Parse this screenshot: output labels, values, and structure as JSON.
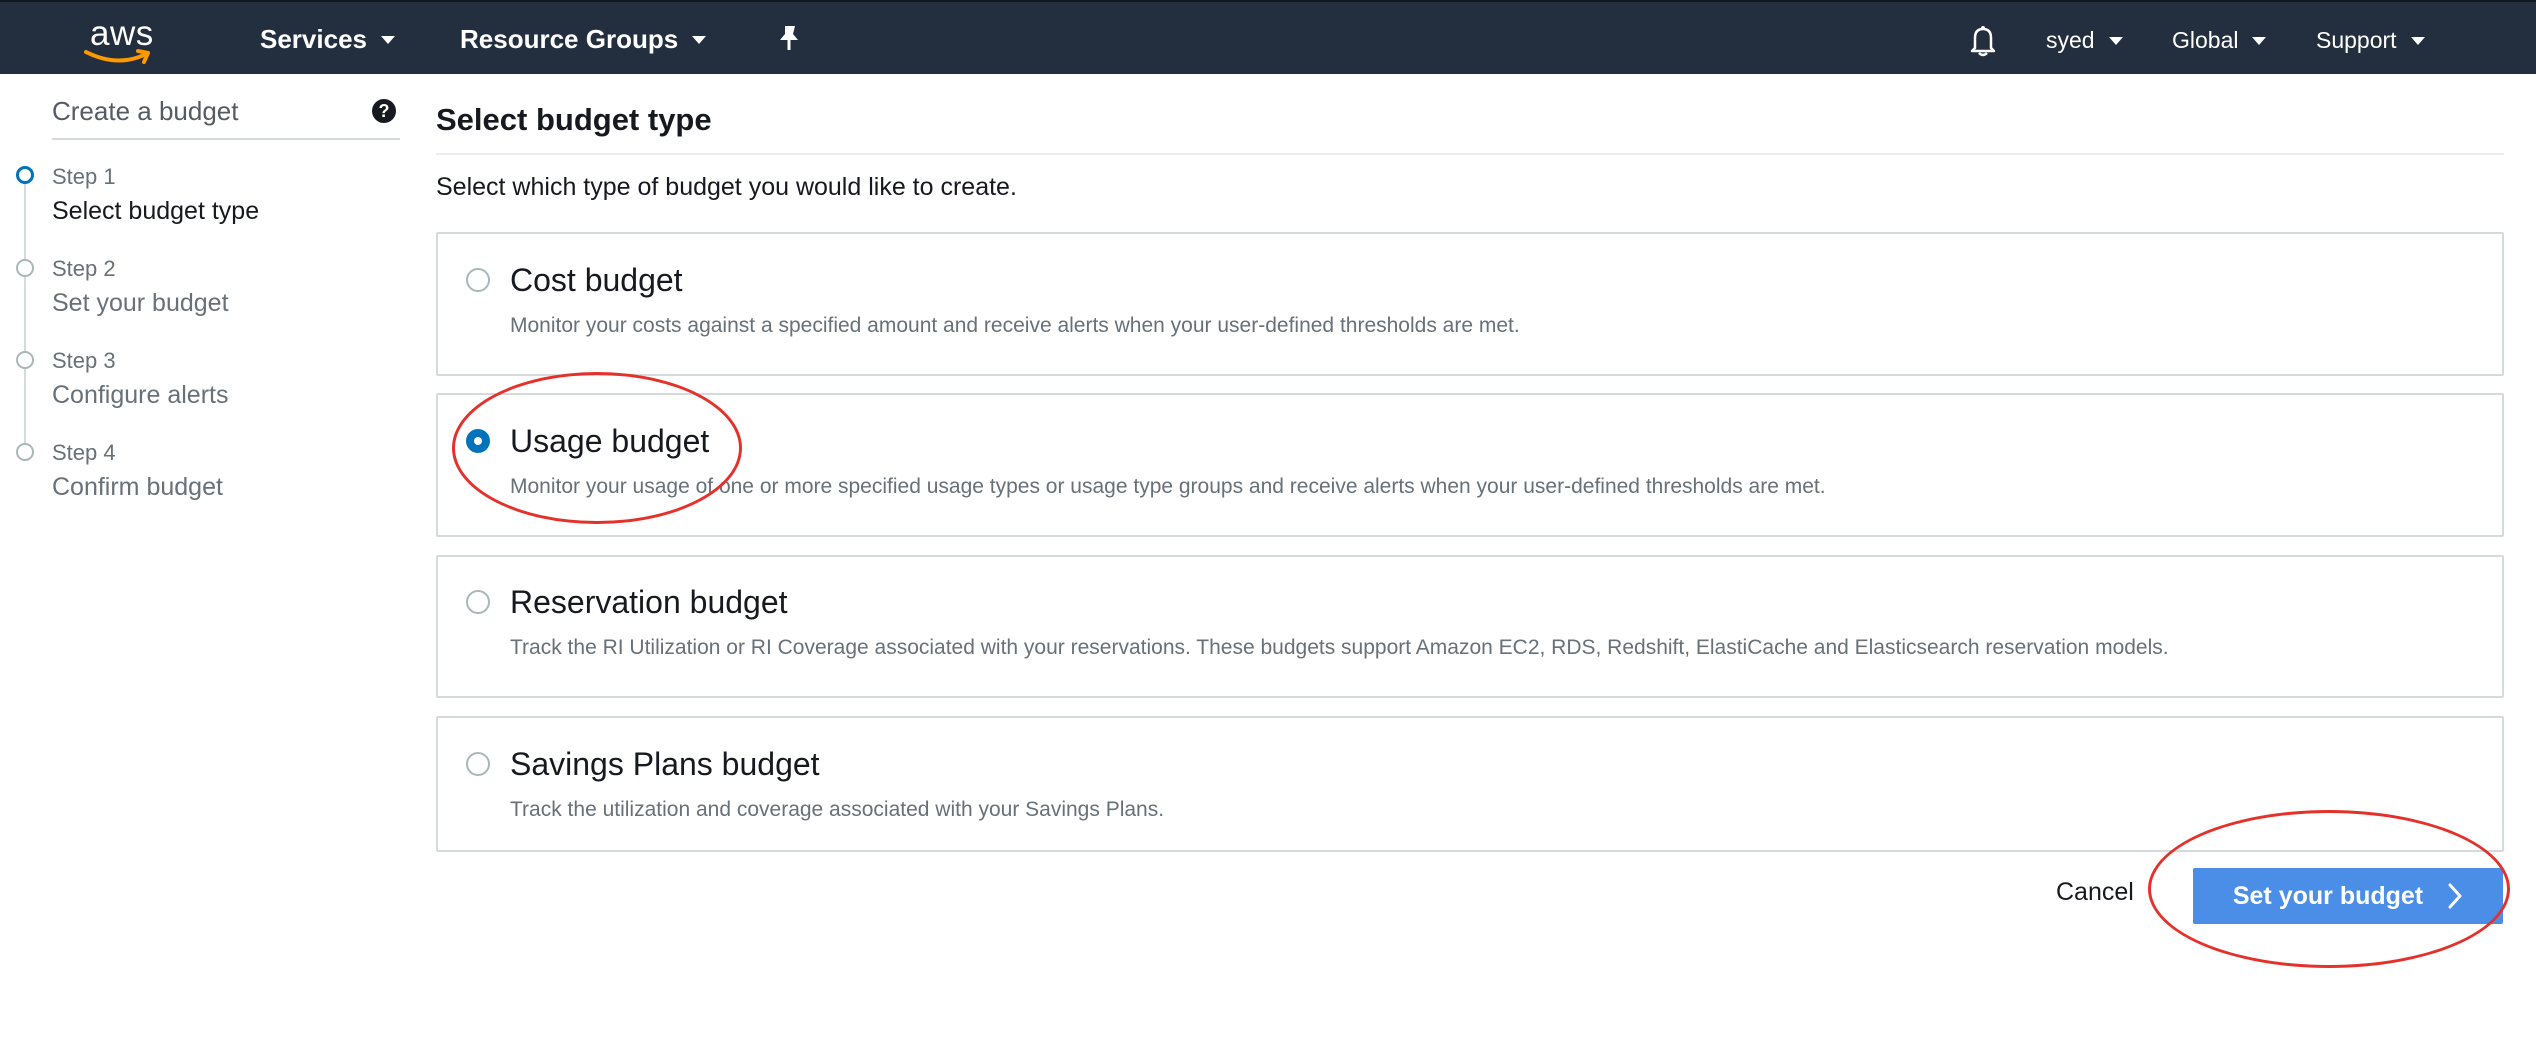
{
  "topbar": {
    "logo_text": "aws",
    "services_label": "Services",
    "resource_groups_label": "Resource Groups",
    "pin_icon": "pin-icon",
    "bell_icon": "bell-icon",
    "user_label": "syed",
    "region_label": "Global",
    "support_label": "Support",
    "bar_color": "#232f3e"
  },
  "sidebar": {
    "title": "Create a budget",
    "help_icon": "question-circle-icon",
    "steps": [
      {
        "num": "Step 1",
        "label": "Select budget type",
        "active": true
      },
      {
        "num": "Step 2",
        "label": "Set your budget",
        "active": false
      },
      {
        "num": "Step 3",
        "label": "Configure alerts",
        "active": false
      },
      {
        "num": "Step 4",
        "label": "Confirm budget",
        "active": false
      }
    ]
  },
  "main": {
    "title": "Select budget type",
    "subtitle": "Select which type of budget you would like to create.",
    "options": [
      {
        "title": "Cost budget",
        "desc": "Monitor your costs against a specified amount and receive alerts when your user-defined thresholds are met.",
        "selected": false
      },
      {
        "title": "Usage budget",
        "desc": "Monitor your usage of one or more specified usage types or usage type groups and receive alerts when your user-defined thresholds are met.",
        "selected": true
      },
      {
        "title": "Reservation budget",
        "desc": "Track the RI Utilization or RI Coverage associated with your reservations. These budgets support Amazon EC2, RDS, Redshift, ElastiCache and Elasticsearch reservation models.",
        "selected": false
      },
      {
        "title": "Savings Plans budget",
        "desc": "Track the utilization and coverage associated with your Savings Plans.",
        "selected": false
      }
    ]
  },
  "footer": {
    "cancel_label": "Cancel",
    "next_label": "Set your budget",
    "next_icon": "chevron-right-icon",
    "accent_color": "#4a8ee8"
  },
  "annotations": {
    "highlight_color": "#e5312b"
  }
}
